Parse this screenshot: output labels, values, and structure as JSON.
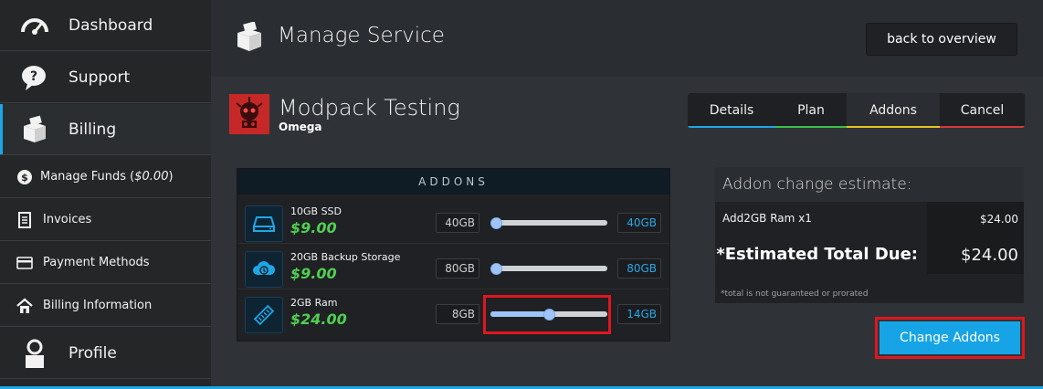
{
  "sidebar": {
    "items": [
      {
        "label": "Dashboard",
        "icon": "dashboard-gauge-icon"
      },
      {
        "label": "Support",
        "icon": "support-question-icon"
      },
      {
        "label": "Billing",
        "icon": "billing-box-icon"
      },
      {
        "label_prefix": "Manage Funds (",
        "label_value": "$0.00",
        "label_suffix": ")",
        "icon": "dollar-coin-icon"
      },
      {
        "label": "Invoices",
        "icon": "invoice-document-icon"
      },
      {
        "label": "Payment Methods",
        "icon": "credit-card-icon"
      },
      {
        "label": "Billing Information",
        "icon": "home-icon"
      },
      {
        "label": "Profile",
        "icon": "user-icon"
      }
    ]
  },
  "header": {
    "title": "Manage Service",
    "back_label": "back to overview"
  },
  "server": {
    "name": "Modpack Testing",
    "subtitle": "Omega"
  },
  "tabs": [
    {
      "label": "Details",
      "color": "#1ea7e6"
    },
    {
      "label": "Plan",
      "color": "#3cc04a"
    },
    {
      "label": "Addons",
      "color": "#e6c61e",
      "active": true
    },
    {
      "label": "Cancel",
      "color": "#d73a3a"
    }
  ],
  "addons": {
    "header": "ADDONS",
    "items": [
      {
        "name": "10GB SSD",
        "price": "$9.00",
        "min": "40GB",
        "max": "40GB",
        "level": 0.0,
        "icon": "ssd-drive-icon"
      },
      {
        "name": "20GB Backup Storage",
        "price": "$9.00",
        "min": "80GB",
        "max": "80GB",
        "level": 0.0,
        "icon": "cloud-backup-icon"
      },
      {
        "name": "2GB Ram",
        "price": "$24.00",
        "min": "8GB",
        "max": "14GB",
        "level": 0.5,
        "icon": "ram-stick-icon"
      }
    ]
  },
  "estimate": {
    "header": "Addon change estimate:",
    "line_label": "Add2GB Ram x1",
    "line_amount": "$24.00",
    "total_label": "*Estimated Total Due:",
    "total_amount": "$24.00",
    "note": "*total is not guaranteed or prorated"
  },
  "actions": {
    "change_label": "Change Addons"
  },
  "colors": {
    "accent": "#1ea7e6",
    "price_green": "#4fd04f",
    "highlight_red": "#e0161f"
  }
}
